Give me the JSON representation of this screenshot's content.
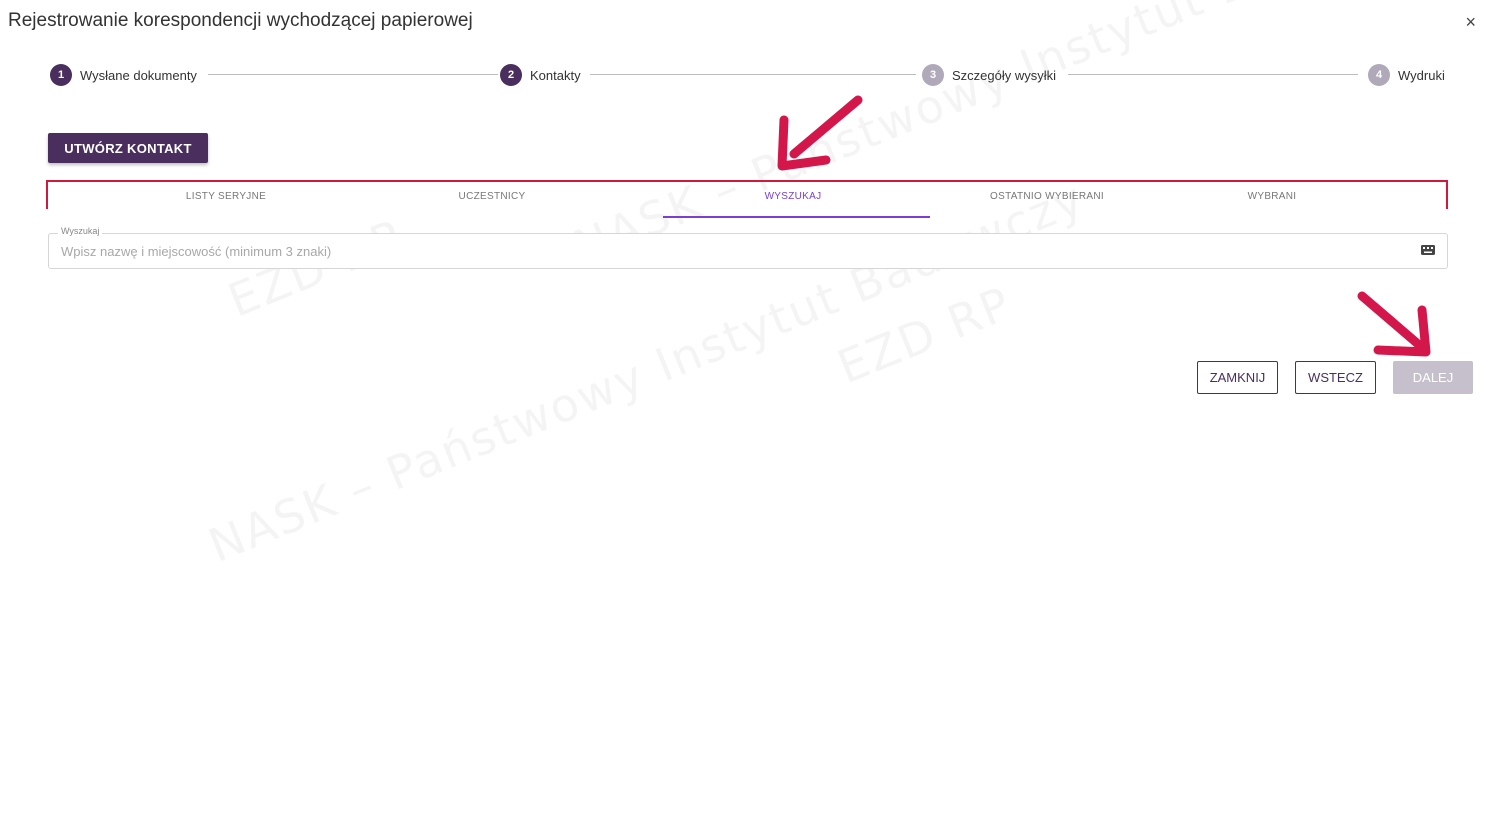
{
  "dialog": {
    "title": "Rejestrowanie korespondencji wychodzącej papierowej",
    "close_label": "×"
  },
  "stepper": {
    "steps": [
      {
        "number": "1",
        "label": "Wysłane dokumenty",
        "state": "active"
      },
      {
        "number": "2",
        "label": "Kontakty",
        "state": "active"
      },
      {
        "number": "3",
        "label": "Szczegóły wysyłki",
        "state": "inactive"
      },
      {
        "number": "4",
        "label": "Wydruki",
        "state": "inactive"
      }
    ]
  },
  "create_contact": {
    "label": "UTWÓRZ KONTAKT"
  },
  "tabs": [
    {
      "label": "LISTY SERYJNE"
    },
    {
      "label": "UCZESTNICY"
    },
    {
      "label": "WYSZUKAJ",
      "selected": true
    },
    {
      "label": "OSTATNIO WYBIERANI"
    },
    {
      "label": "WYBRANI"
    }
  ],
  "search": {
    "legend": "Wyszukaj",
    "placeholder": "Wpisz nazwę i miejscowość (minimum 3 znaki)",
    "value": "",
    "icon": "keyboard-icon"
  },
  "footer": {
    "close_label": "ZAMKNIJ",
    "back_label": "WSTECZ",
    "next_label": "DALEJ"
  },
  "watermark": {
    "line1": "EZD RP",
    "line2": "NASK – Państwowy Instytut Badawczy"
  },
  "colors": {
    "primary": "#4a2f5e",
    "accent_tab": "#7a3fd1",
    "highlight_border": "#d0193f",
    "annotation_arrow": "#d4174a",
    "inactive_step": "#b0a9b9",
    "disabled_button": "#c5c0cc"
  }
}
